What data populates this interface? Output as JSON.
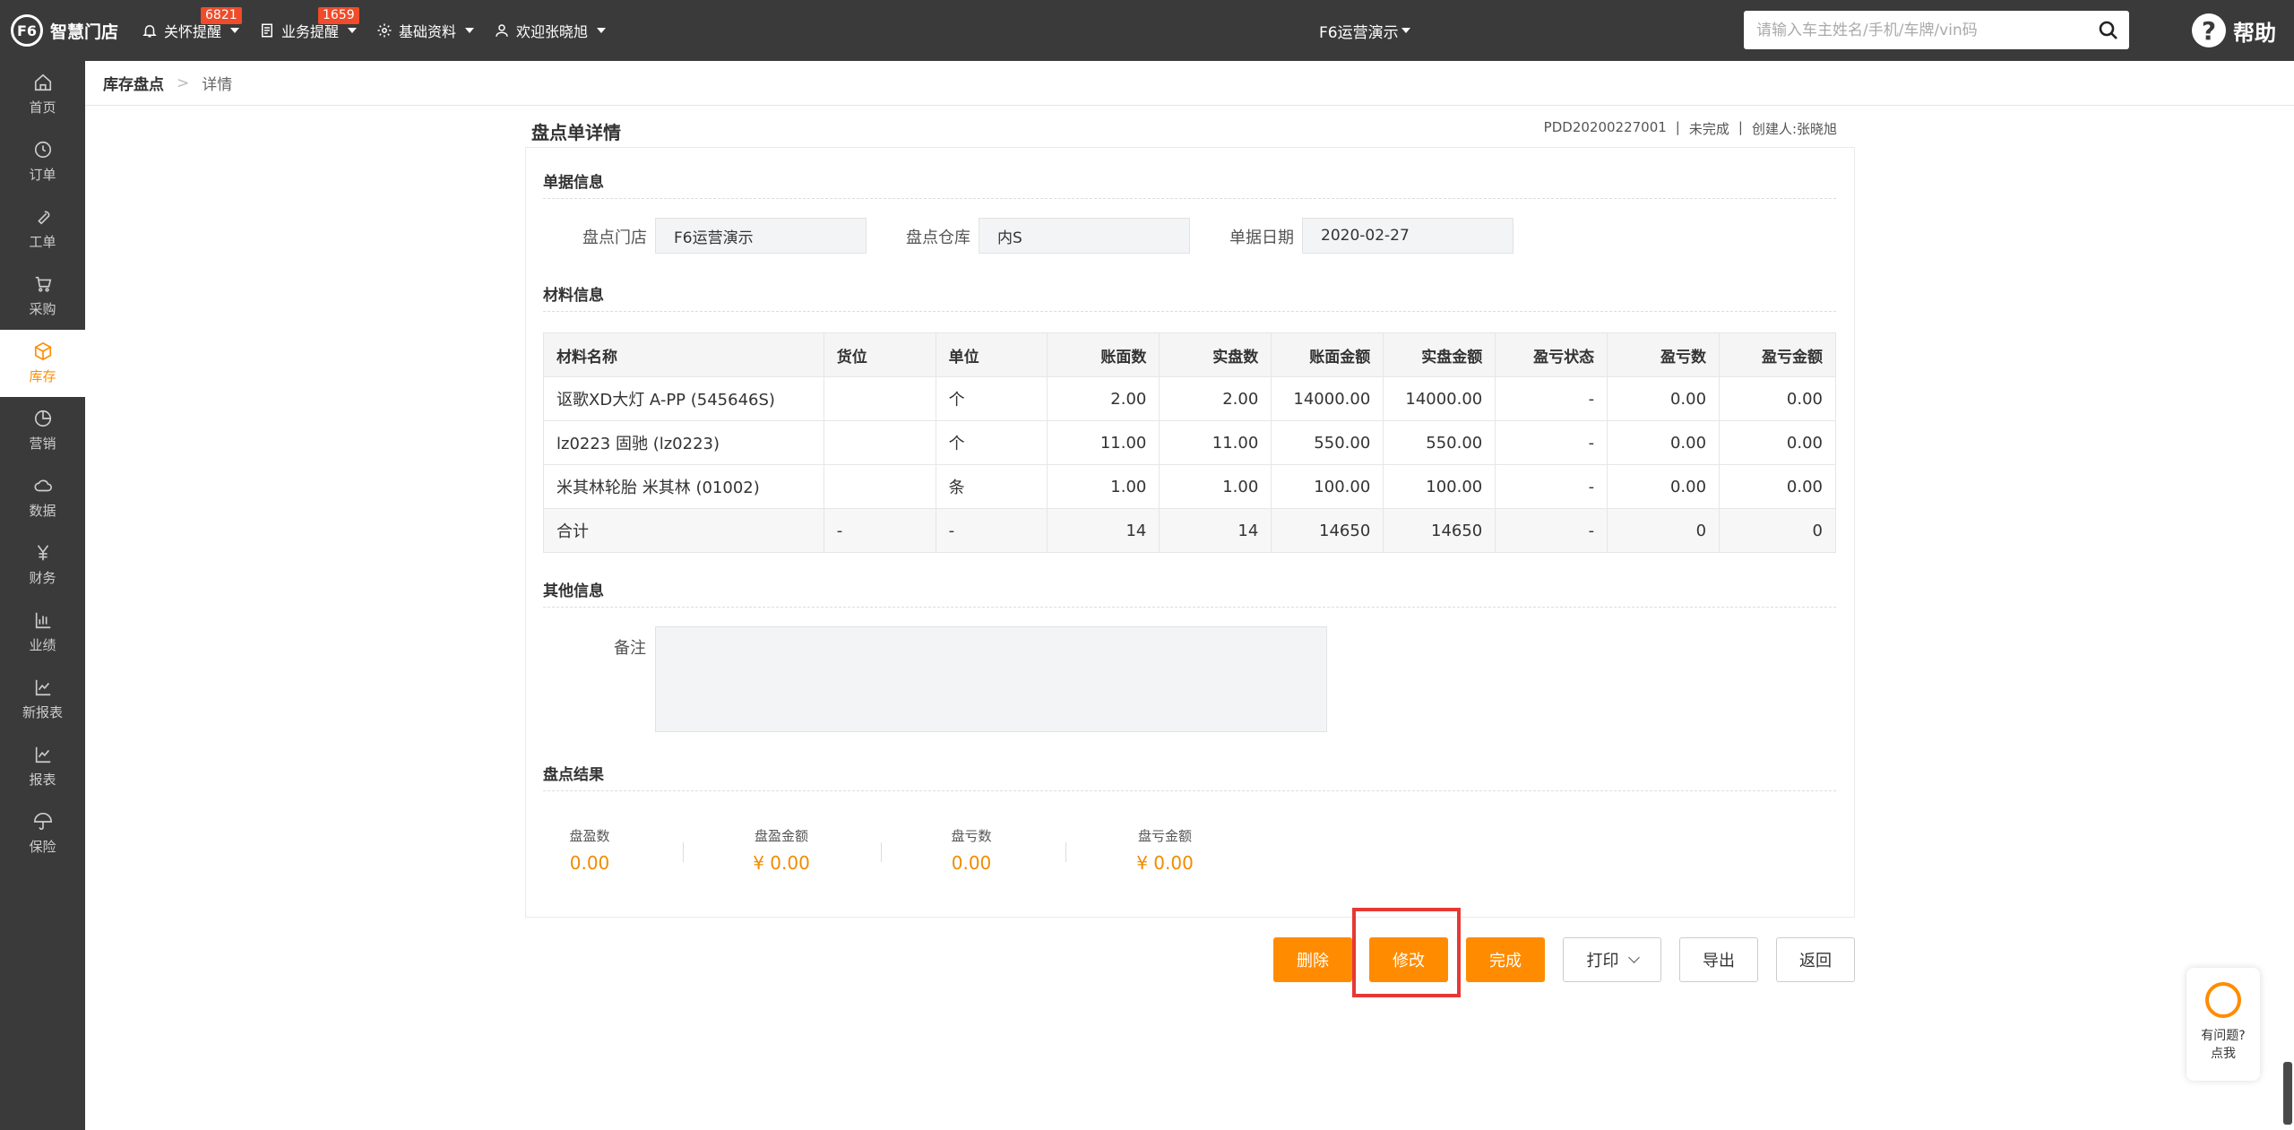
{
  "app": {
    "logo_text": "智慧门店",
    "logo_mark": "F6",
    "nav": [
      {
        "label": "关怀提醒",
        "badge": "6821"
      },
      {
        "label": "业务提醒",
        "badge": "1659"
      },
      {
        "label": "基础资料",
        "badge": ""
      },
      {
        "label": "欢迎张晓旭",
        "badge": ""
      }
    ],
    "store": "F6运营演示",
    "search_placeholder": "请输入车主姓名/手机/车牌/vin码",
    "help_label": "帮助",
    "help_mark": "?"
  },
  "sidebar": [
    {
      "label": "首页",
      "icon": "home-icon"
    },
    {
      "label": "订单",
      "icon": "history-icon"
    },
    {
      "label": "工单",
      "icon": "wrench-icon"
    },
    {
      "label": "采购",
      "icon": "cart-icon"
    },
    {
      "label": "库存",
      "icon": "box-icon",
      "active": true
    },
    {
      "label": "营销",
      "icon": "pie-icon"
    },
    {
      "label": "数据",
      "icon": "cloud-icon"
    },
    {
      "label": "财务",
      "icon": "yen-icon"
    },
    {
      "label": "业绩",
      "icon": "bar-chart-icon"
    },
    {
      "label": "新报表",
      "icon": "line-chart-icon"
    },
    {
      "label": "报表",
      "icon": "line-chart-icon"
    },
    {
      "label": "保险",
      "icon": "umbrella-icon"
    }
  ],
  "breadcrumb": {
    "main": "库存盘点",
    "sep": ">",
    "sub": "详情"
  },
  "page": {
    "title": "盘点单详情",
    "doc_no": "PDD20200227001",
    "status": "未完成",
    "creator": "创建人:张晓旭",
    "sep": "|"
  },
  "sections": {
    "doc_info": "单据信息",
    "material_info": "材料信息",
    "other_info": "其他信息",
    "result": "盘点结果"
  },
  "doc_fields": {
    "store_label": "盘点门店",
    "store_value": "F6运营演示",
    "warehouse_label": "盘点仓库",
    "warehouse_value": "内S",
    "date_label": "单据日期",
    "date_value": "2020-02-27"
  },
  "table": {
    "headers": [
      "材料名称",
      "货位",
      "单位",
      "账面数",
      "实盘数",
      "账面金额",
      "实盘金额",
      "盈亏状态",
      "盈亏数",
      "盈亏金额"
    ],
    "rows": [
      [
        "讴歌XD大灯 A-PP (545646S)",
        "",
        "个",
        "2.00",
        "2.00",
        "14000.00",
        "14000.00",
        "-",
        "0.00",
        "0.00"
      ],
      [
        "lz0223 固驰 (lz0223)",
        "",
        "个",
        "11.00",
        "11.00",
        "550.00",
        "550.00",
        "-",
        "0.00",
        "0.00"
      ],
      [
        "米其林轮胎 米其林 (01002)",
        "",
        "条",
        "1.00",
        "1.00",
        "100.00",
        "100.00",
        "-",
        "0.00",
        "0.00"
      ]
    ],
    "total": [
      "合计",
      "-",
      "-",
      "14",
      "14",
      "14650",
      "14650",
      "-",
      "0",
      "0"
    ]
  },
  "remark": {
    "label": "备注",
    "value": ""
  },
  "stats": [
    {
      "label": "盘盈数",
      "value": "0.00"
    },
    {
      "label": "盘盈金额",
      "value": "¥ 0.00"
    },
    {
      "label": "盘亏数",
      "value": "0.00"
    },
    {
      "label": "盘亏金额",
      "value": "¥ 0.00"
    }
  ],
  "buttons": {
    "delete": "删除",
    "edit": "修改",
    "complete": "完成",
    "print": "打印",
    "export": "导出",
    "back": "返回"
  },
  "float_help": {
    "line1": "有问题?",
    "line2": "点我"
  },
  "colors": {
    "accent": "#ff8c00",
    "topbar": "#3a3a3a",
    "badge": "#f04b2a",
    "highlight": "#e53935"
  }
}
